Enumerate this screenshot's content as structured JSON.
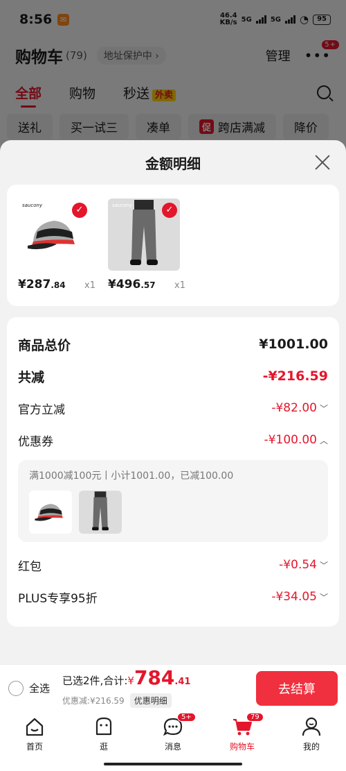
{
  "status": {
    "time": "8:56",
    "speed_top": "46.4",
    "speed_unit": "KB/s",
    "net1": "5G",
    "net2": "5G",
    "battery": "95"
  },
  "header": {
    "title": "购物车",
    "count": "(79)",
    "address": "地址保护中 ›",
    "manage": "管理",
    "more_badge": "5+"
  },
  "tabs": {
    "all": "全部",
    "shopping": "购物",
    "instant": "秒送",
    "instant_badge": "外卖"
  },
  "chips": [
    "送礼",
    "买一试三",
    "凑单",
    "跨店满减",
    "降价"
  ],
  "chip_promo_tag": "促",
  "sheet": {
    "title": "金额明细"
  },
  "products": [
    {
      "brand": "saucony",
      "price_int": "¥287",
      "price_dec": ".84",
      "qty": "x1",
      "icon": "cap"
    },
    {
      "brand": "saucony",
      "price_int": "¥496",
      "price_dec": ".57",
      "qty": "x1",
      "icon": "pants"
    }
  ],
  "details": {
    "subtotal_label": "商品总价",
    "subtotal_value": "¥1001.00",
    "reduced_label": "共减",
    "reduced_value": "-¥216.59",
    "official_label": "官方立减",
    "official_value": "-¥82.00",
    "coupon_label": "优惠券",
    "coupon_value": "-¥100.00",
    "coupon_desc": "满1000减100元丨小计1001.00，已减100.00",
    "redpacket_label": "红包",
    "redpacket_value": "-¥0.54",
    "plus_label": "PLUS专享95折",
    "plus_value": "-¥34.05"
  },
  "bottom": {
    "select_all": "全选",
    "selected": "已选2件,合计:",
    "currency": "¥",
    "total_int": "784",
    "total_dec": ".41",
    "discount": "优惠减:¥216.59",
    "detail_btn": "优惠明细",
    "checkout": "去结算"
  },
  "nav": [
    {
      "label": "首页",
      "icon": "home-icon"
    },
    {
      "label": "逛",
      "icon": "face-icon"
    },
    {
      "label": "消息",
      "icon": "chat-icon",
      "badge": "5+"
    },
    {
      "label": "购物车",
      "icon": "cart-icon",
      "badge": "79"
    },
    {
      "label": "我的",
      "icon": "user-icon"
    }
  ],
  "colors": {
    "accent": "#e4162b",
    "checkout": "#f0303f"
  }
}
